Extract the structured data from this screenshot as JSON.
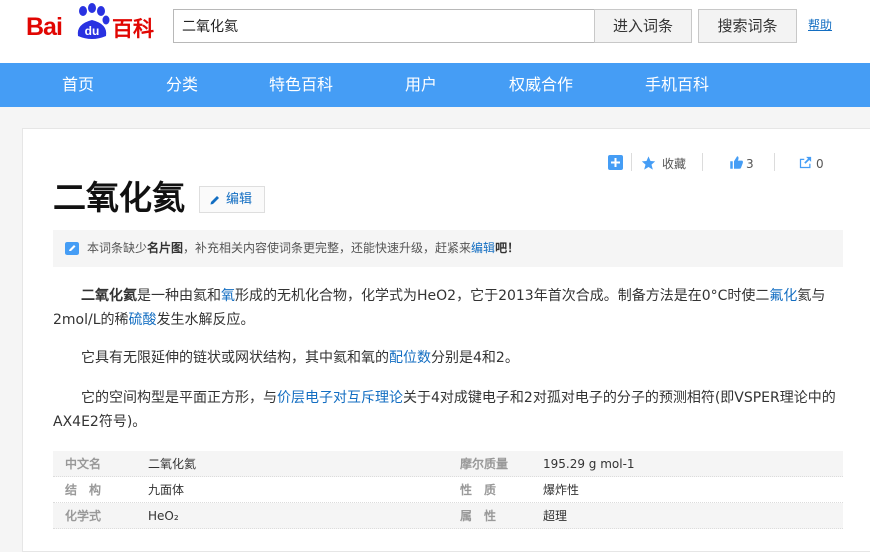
{
  "header": {
    "logo_bai": "Bai",
    "logo_du": "du",
    "logo_baike": "百科",
    "search_value": "二氧化氦",
    "enter_button": "进入词条",
    "search_button": "搜索词条",
    "help_link": "帮助"
  },
  "nav": {
    "items": [
      "首页",
      "分类",
      "特色百科",
      "用户",
      "权威合作",
      "手机百科"
    ]
  },
  "tools": {
    "favorite_label": "收藏",
    "like_count": "3",
    "share_count": "0"
  },
  "entry": {
    "title": "二氧化氦",
    "edit_label": "编辑"
  },
  "notice": {
    "prefix": "本词条缺少",
    "missing": "名片图",
    "middle": "，补充相关内容使词条更完整，还能快速升级，赶紧来",
    "edit_link": "编辑",
    "suffix": "吧！"
  },
  "paragraphs": {
    "p1_strong": "二氧化氦",
    "p1_a": "是一种由氦和",
    "p1_link1": "氧",
    "p1_b": "形成的无机化合物，化学式为HeO2，它于2013年首次合成。制备方法是在0°C时使二",
    "p1_link2": "氟化",
    "p1_c": "氦与2mol/L的稀",
    "p1_link3": "硫酸",
    "p1_d": "发生水解反应。",
    "p2_a": "它具有无限延伸的链状或网状结构，其中氦和氧的",
    "p2_link": "配位数",
    "p2_b": "分别是4和2。",
    "p3_a": "它的空间构型是平面正方形，与",
    "p3_link": "价层电子对互斥理论",
    "p3_b": "关于4对成键电子和2对孤对电子的分子的预测相符(即VSPER理论中的AX4E2符号)。"
  },
  "info": [
    {
      "label_left": "中文名",
      "value_left": "二氧化氦",
      "label_right": "摩尔质量",
      "value_right": "195.29 g mol-1"
    },
    {
      "label_left": "结　构",
      "value_left": "九面体",
      "label_right": "性　质",
      "value_right": "爆炸性"
    },
    {
      "label_left": "化学式",
      "value_left": "HeO₂",
      "label_right": "属　性",
      "value_right": "超理"
    }
  ],
  "colors": {
    "nav_bg": "#459df5",
    "brand_red": "#e10602",
    "link_blue": "#136ec2"
  }
}
